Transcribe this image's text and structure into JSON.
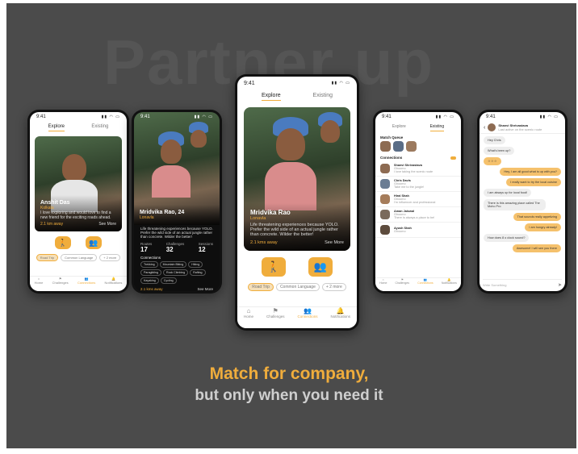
{
  "hero": {
    "background_word": "Partner up"
  },
  "tagline": {
    "line1": "Match for company,",
    "line2": "but only when you need it"
  },
  "colors": {
    "accent": "#f0ad3c",
    "board": "#4b4b4b",
    "dark_screen": "#0e0e0e"
  },
  "phone1": {
    "time": "9:41",
    "tabs": [
      "Explore",
      "Existing"
    ],
    "profile": {
      "name": "Anshit Das",
      "location": "Kolkata",
      "bio": "I love exploring and would love to find a new friend for the exciting roads ahead.",
      "distance": "2.1 km away",
      "see_more": "See More"
    },
    "chips": [
      "Road Trip",
      "Common Language",
      "+ 2 more"
    ],
    "nav": [
      "Home",
      "Challenges",
      "Connections",
      "Notifications"
    ]
  },
  "phone2": {
    "time": "9:41",
    "profile": {
      "name": "Mridvika Rao, 24",
      "location": "Lonavla",
      "bio": "Life threatening experiences because YOLO. Prefer the wild side of an actual jungle rather than concrete. Wilder the better!"
    },
    "stats": [
      {
        "label": "Routes",
        "value": "17"
      },
      {
        "label": "Challenges",
        "value": "32"
      },
      {
        "label": "Sessions",
        "value": "12"
      }
    ],
    "connections_label": "Connections",
    "chips": [
      "Trekking",
      "Mountain Biking",
      "Hiking",
      "Paragliding",
      "Rock Climbing",
      "Rafting",
      "Kayaking",
      "Cycling"
    ],
    "distance": "2.1 kms away",
    "see_more": "See More"
  },
  "phone3": {
    "time": "9:41",
    "tabs": [
      "Explore",
      "Existing"
    ],
    "profile": {
      "name": "Mridvika Rao",
      "location": "Lonavla",
      "bio": "Life threatening experiences because YOLO. Prefer the wild side of an actual jungle rather than concrete. Wilder the better!",
      "distance": "2.1 kms away",
      "see_more": "See More"
    },
    "chips": [
      "Road Trip",
      "Common Language",
      "+ 2 more"
    ],
    "nav": [
      "Home",
      "Challenges",
      "Connections",
      "Notifications"
    ]
  },
  "phone4": {
    "time": "9:41",
    "tabs": [
      "Explore",
      "Existing"
    ],
    "queue_label": "Match Queue",
    "connections_label": "Connections",
    "connections": [
      {
        "name": "Shanvi Shrivastava",
        "sub": "Ghoomo",
        "msg": "I love taking the scenic route"
      },
      {
        "name": "Chris Davis",
        "sub": "Ghoomo",
        "msg": "Take me to the jungle!"
      },
      {
        "name": "Hiral Shah",
        "sub": "Ghoomo",
        "msg": "I'm influencer and professional"
      },
      {
        "name": "Aman Jaiswal",
        "sub": "Ghoomo",
        "msg": "There is always a place to be!"
      },
      {
        "name": "Ayush Shah",
        "sub": "Ghoomo",
        "msg": ""
      }
    ],
    "nav": [
      "Home",
      "Challenges",
      "Connections",
      "Notifications"
    ]
  },
  "phone5": {
    "time": "9:41",
    "contact": {
      "name": "Shanvi Shrivastava",
      "status": "Last active on the scenic route"
    },
    "messages": [
      {
        "side": "left",
        "text": "Hey Chris"
      },
      {
        "side": "left",
        "text": "What's been up?"
      },
      {
        "side": "left",
        "text": "☺☺☺"
      },
      {
        "side": "right",
        "text": "Hey, I am all good what is up with you?"
      },
      {
        "side": "right",
        "text": "I really want to try the local cuisine"
      },
      {
        "side": "left",
        "text": "I am always up for local food!"
      },
      {
        "side": "left",
        "text": "There is this amazing place called The Moho Pro"
      },
      {
        "side": "right",
        "text": "That sounds really appetizing"
      },
      {
        "side": "right",
        "text": "I am hungry already!"
      },
      {
        "side": "left",
        "text": "How does 8 o clock sound?"
      },
      {
        "side": "right",
        "text": "Awesome! I will see you there"
      }
    ],
    "input_placeholder": "Write Something"
  }
}
